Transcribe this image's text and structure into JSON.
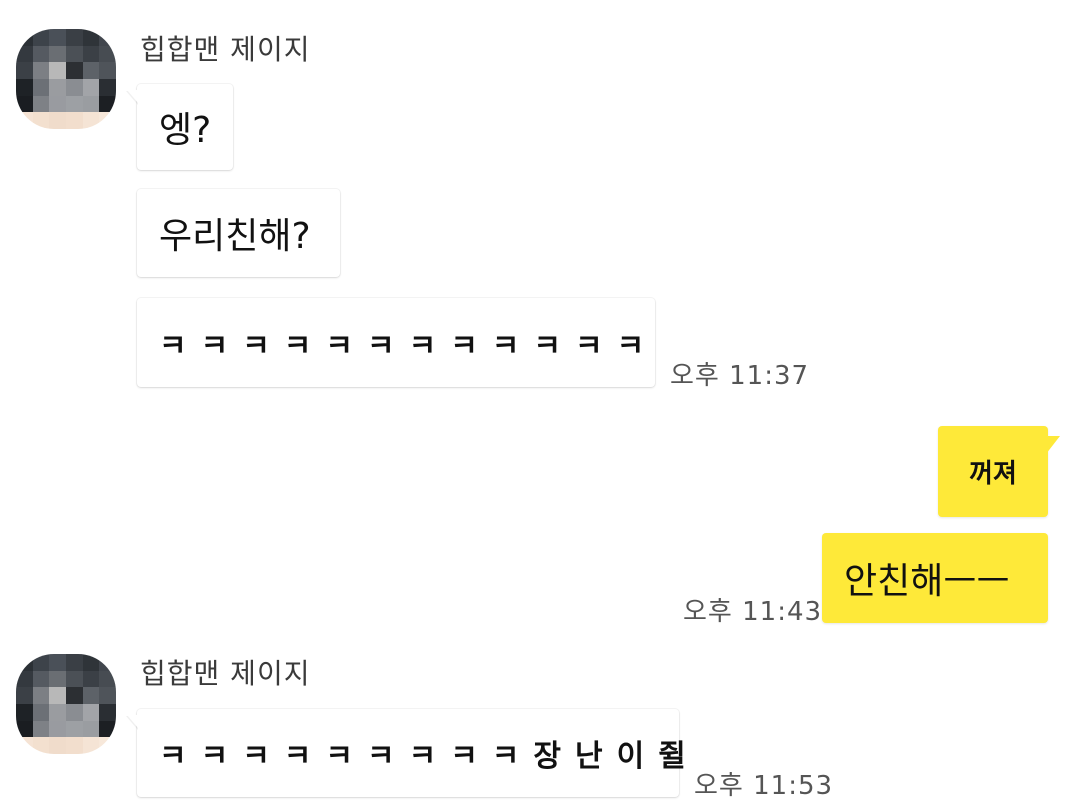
{
  "messages": {
    "group1": {
      "sender": "힙합맨 제이지",
      "bubbles": [
        "엥?",
        "우리친해?",
        "ㅋㅋㅋㅋㅋㅋㅋㅋㅋㅋㅋㅋ"
      ],
      "time": "오후 11:37"
    },
    "group2": {
      "bubbles": [
        "꺼져",
        "안친해ㅡㅡ"
      ],
      "time": "오후 11:43"
    },
    "group3": {
      "sender": "힙합맨 제이지",
      "bubbles": [
        "ㅋㅋㅋㅋㅋㅋㅋㅋㅋ장난이쥘"
      ],
      "time": "오후 11:53"
    }
  },
  "colors": {
    "sent_bubble": "#fee939",
    "received_bubble": "#ffffff",
    "background": "#ffffff"
  },
  "icons": {
    "avatar": "blurred-profile-photo"
  }
}
